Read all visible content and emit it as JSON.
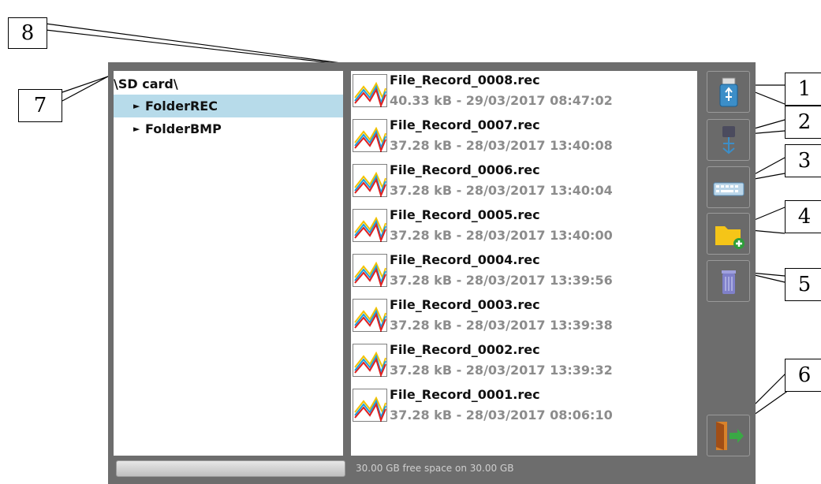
{
  "folder_tree": {
    "root": "\\SD card\\",
    "items": [
      {
        "label": "FolderREC",
        "selected": true
      },
      {
        "label": "FolderBMP",
        "selected": false
      }
    ]
  },
  "files": [
    {
      "name": "File_Record_0008.rec",
      "meta": "40.33 kB - 29/03/2017 08:47:02"
    },
    {
      "name": "File_Record_0007.rec",
      "meta": "37.28 kB - 28/03/2017 13:40:08"
    },
    {
      "name": "File_Record_0006.rec",
      "meta": "37.28 kB - 28/03/2017 13:40:04"
    },
    {
      "name": "File_Record_0005.rec",
      "meta": "37.28 kB - 28/03/2017 13:40:00"
    },
    {
      "name": "File_Record_0004.rec",
      "meta": "37.28 kB - 28/03/2017 13:39:56"
    },
    {
      "name": "File_Record_0003.rec",
      "meta": "37.28 kB - 28/03/2017 13:39:38"
    },
    {
      "name": "File_Record_0002.rec",
      "meta": "37.28 kB - 28/03/2017 13:39:32"
    },
    {
      "name": "File_Record_0001.rec",
      "meta": "37.28 kB - 28/03/2017 08:06:10"
    }
  ],
  "toolbar": [
    {
      "icon": "usb-drive-icon"
    },
    {
      "icon": "usb-eject-icon"
    },
    {
      "icon": "keyboard-icon"
    },
    {
      "icon": "new-folder-icon"
    },
    {
      "icon": "trash-icon"
    },
    {
      "icon": "exit-door-icon"
    }
  ],
  "status": {
    "free_space": "30.00 GB free space on 30.00 GB"
  },
  "callouts": [
    "1",
    "2",
    "3",
    "4",
    "5",
    "6",
    "7",
    "8"
  ],
  "colors": {
    "frame": "#6d6d6d",
    "selection": "#b7dbea",
    "meta_text": "#8c8c8c",
    "folder": "#f5c518",
    "trash": "#7f80c9"
  }
}
